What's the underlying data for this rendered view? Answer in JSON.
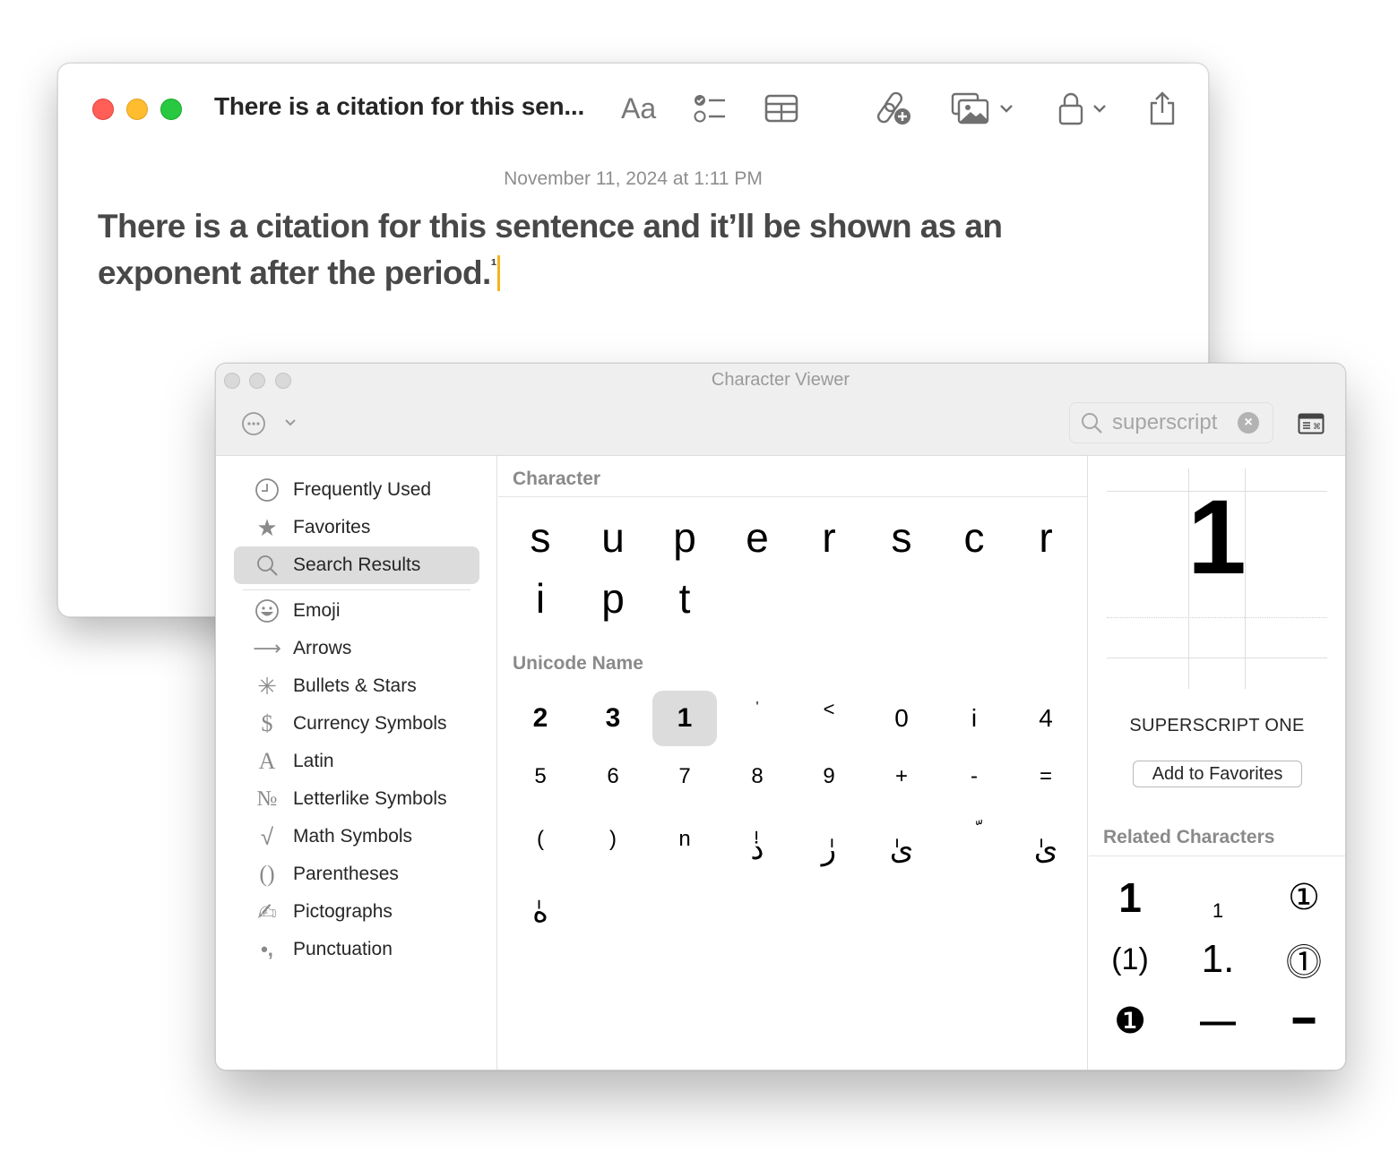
{
  "notes_window": {
    "title": "There is a citation for this sen...",
    "toolbar": {
      "format_label": "Aa",
      "icons": [
        "checklist-icon",
        "table-icon",
        "collaborate-icon",
        "media-icon",
        "lock-icon",
        "share-icon"
      ]
    },
    "date": "November 11, 2024 at 1:11 PM",
    "body_text": "There is a citation for this sentence and it’ll be shown as an exponent after the period.",
    "body_superscript": "¹"
  },
  "character_viewer": {
    "title": "Character Viewer",
    "search": {
      "value": "superscript",
      "placeholder": "Search"
    },
    "sidebar": {
      "items": [
        {
          "label": "Frequently Used",
          "icon": "clock-icon",
          "selected": false
        },
        {
          "label": "Favorites",
          "icon": "star-icon",
          "selected": false
        },
        {
          "label": "Search Results",
          "icon": "search-icon",
          "selected": true
        },
        {
          "label": "Emoji",
          "icon": "smiley-icon",
          "selected": false
        },
        {
          "label": "Arrows",
          "icon": "arrow-icon",
          "selected": false
        },
        {
          "label": "Bullets & Stars",
          "icon": "bullets-stars-icon",
          "selected": false
        },
        {
          "label": "Currency Symbols",
          "icon": "dollar-icon",
          "selected": false
        },
        {
          "label": "Latin",
          "icon": "latin-a-icon",
          "selected": false
        },
        {
          "label": "Letterlike Symbols",
          "icon": "numero-icon",
          "selected": false
        },
        {
          "label": "Math Symbols",
          "icon": "square-root-icon",
          "selected": false
        },
        {
          "label": "Parentheses",
          "icon": "parentheses-icon",
          "selected": false
        },
        {
          "label": "Pictographs",
          "icon": "writing-hand-icon",
          "selected": false
        },
        {
          "label": "Punctuation",
          "icon": "punctuation-icon",
          "selected": false
        }
      ],
      "icon_glyphs": [
        "◷",
        "★",
        "",
        "☺",
        "⟶",
        "✳",
        "$",
        "A",
        "№",
        "√",
        "()",
        "✍",
        "•,"
      ]
    },
    "character_section": {
      "header": "Character",
      "chars": [
        "s",
        "u",
        "p",
        "e",
        "r",
        "s",
        "c",
        "r",
        "i",
        "p",
        "t"
      ]
    },
    "unicode_section": {
      "header": "Unicode Name",
      "chars": [
        "²",
        "³",
        "¹",
        "ˈ",
        "͡",
        "⁰",
        "ⁱ",
        "⁴",
        "⁵",
        "⁶",
        "⁷",
        "⁸",
        "⁹",
        "⁺",
        "⁻",
        "⁼",
        "⁽",
        "⁾",
        "ⁿ",
        "ذٰ",
        "رٰ",
        "ىٰ",
        "ّ",
        "ىٰ",
        "هٰ"
      ],
      "display": [
        "2",
        "3",
        "1",
        "ˈ",
        "˂",
        "0",
        "i",
        "4",
        "5",
        "6",
        "7",
        "8",
        "9",
        "+",
        "-",
        "=",
        "(",
        ")",
        "n",
        "ذٰ",
        "رٰ",
        "ىٰ",
        "ّ",
        "ىٰ",
        "هٰ"
      ],
      "selected_index": 2
    },
    "detail": {
      "preview_char": "1",
      "name": "SUPERSCRIPT ONE",
      "add_favorites_label": "Add to Favorites",
      "related_header": "Related Characters",
      "related": [
        "1",
        "1",
        "①",
        "(1)",
        "1.",
        "⓵",
        "❶",
        "—",
        "━"
      ]
    }
  }
}
